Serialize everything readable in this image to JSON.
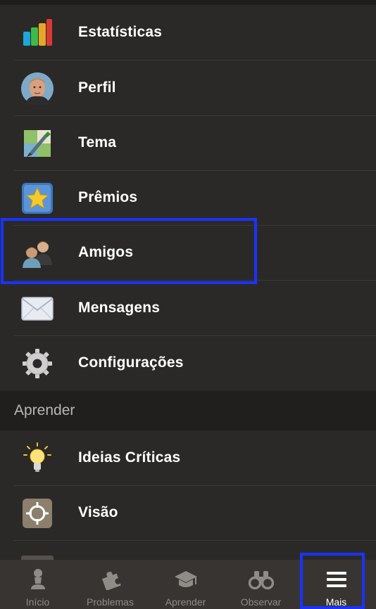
{
  "menu": {
    "items": [
      {
        "label": "Estatísticas",
        "icon": "bar-chart-icon"
      },
      {
        "label": "Perfil",
        "icon": "profile-avatar-icon"
      },
      {
        "label": "Tema",
        "icon": "theme-brush-icon"
      },
      {
        "label": "Prêmios",
        "icon": "star-award-icon"
      },
      {
        "label": "Amigos",
        "icon": "friends-icon"
      },
      {
        "label": "Mensagens",
        "icon": "envelope-icon"
      },
      {
        "label": "Configurações",
        "icon": "gear-icon"
      }
    ]
  },
  "learn_section": {
    "header": "Aprender",
    "items": [
      {
        "label": "Ideias Críticas",
        "icon": "lightbulb-icon"
      },
      {
        "label": "Visão",
        "icon": "crosshair-icon"
      }
    ]
  },
  "tabbar": {
    "tabs": [
      {
        "label": "Início",
        "icon": "pawn-icon"
      },
      {
        "label": "Problemas",
        "icon": "puzzle-icon"
      },
      {
        "label": "Aprender",
        "icon": "graduation-cap-icon"
      },
      {
        "label": "Observar",
        "icon": "binoculars-icon"
      },
      {
        "label": "Mais",
        "icon": "hamburger-menu-icon"
      }
    ],
    "active": "Mais"
  },
  "colors": {
    "background": "#2b2927",
    "section_header_bg": "#211f1d",
    "tabbar_bg": "#373431",
    "highlight": "#1a33ff"
  }
}
